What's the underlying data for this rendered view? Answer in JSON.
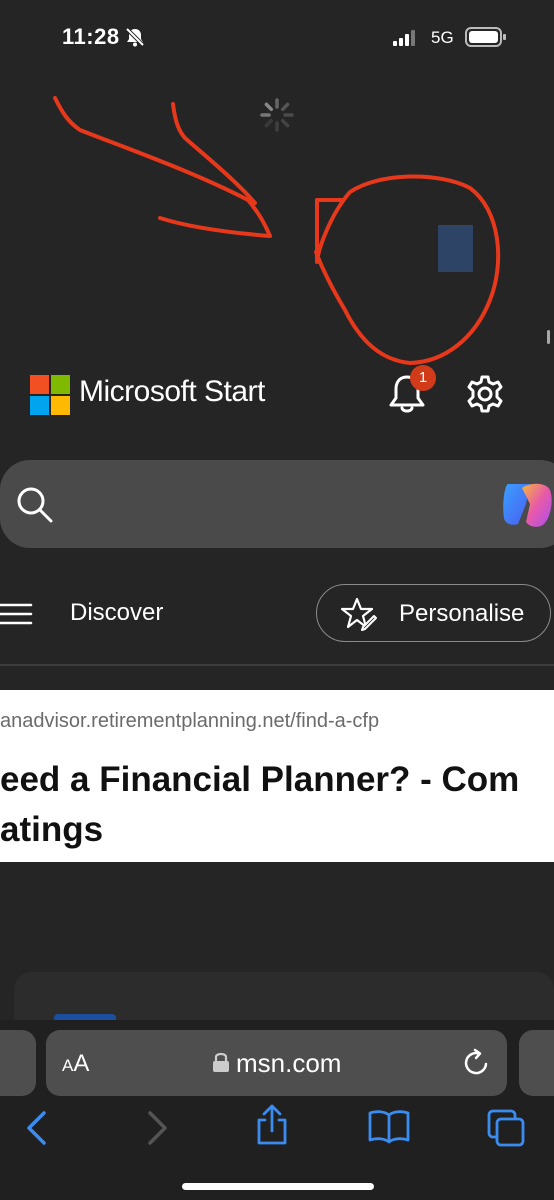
{
  "status_bar": {
    "time": "11:28",
    "network": "5G",
    "icons": [
      "bell-slash-icon",
      "signal-icon",
      "battery-icon"
    ]
  },
  "page": {
    "loading_icon": "spinner-icon"
  },
  "annotation": {
    "color": "#e8381b",
    "description_icons": [
      "arrow-scribble",
      "circle-scribble"
    ]
  },
  "header": {
    "brand": "Microsoft Start",
    "notification_count": "1",
    "icons": [
      "microsoft-logo-icon",
      "bell-icon",
      "gear-icon"
    ]
  },
  "search": {
    "icons": [
      "search-icon",
      "copilot-icon"
    ]
  },
  "nav": {
    "menu_icon": "hamburger-icon",
    "discover_label": "Discover",
    "personalise_label": "Personalise",
    "personalise_icon": "star-pen-icon"
  },
  "ad": {
    "url": "anadvisor.retirementplanning.net/find-a-cfp",
    "title_line1": "eed a Financial Planner? - Com",
    "title_line2": "atings"
  },
  "browser": {
    "aa_label_small": "A",
    "aa_label_large": "A",
    "domain": "msn.com",
    "icons": [
      "lock-icon",
      "reload-icon",
      "back-icon",
      "forward-icon",
      "share-icon",
      "bookmarks-icon",
      "tabs-icon"
    ]
  },
  "colors": {
    "background": "#252525",
    "accent_blue": "#3b8cf0",
    "badge_red": "#d13b1a"
  }
}
